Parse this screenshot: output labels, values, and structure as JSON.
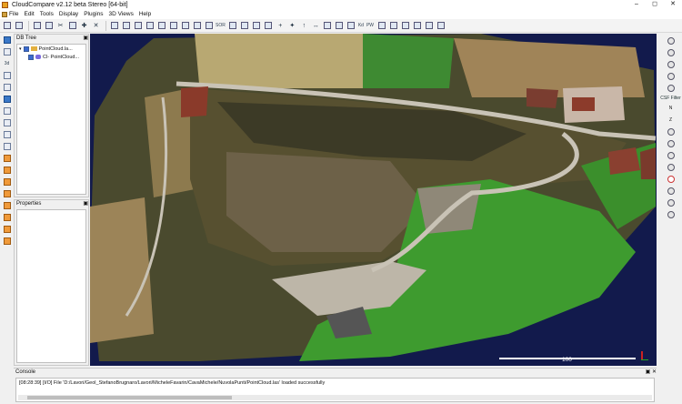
{
  "window": {
    "title": "CloudCompare v2.12 beta Stereo [64-bit]",
    "buttons": [
      "–",
      "◻",
      "✕"
    ]
  },
  "menu": [
    "File",
    "Edit",
    "Tools",
    "Display",
    "Plugins",
    "3D Views",
    "Help"
  ],
  "toolbar": {
    "sor_label": "SOR",
    "kd_label": "Kd",
    "pw_label": "PW"
  },
  "lefttools": {
    "label_3d": "3d"
  },
  "db_tree": {
    "title": "DB Tree",
    "items": [
      {
        "label": "PointCloud.la..."
      },
      {
        "label": "Cl- PointCloud..."
      }
    ]
  },
  "properties": {
    "title": "Properties"
  },
  "viewport": {
    "scale_label": "100"
  },
  "righttools": {
    "csf_label": "CSF Filter",
    "n_label": "N",
    "z_label": "Z"
  },
  "console": {
    "title": "Console",
    "line": "[08:28:39] [I/O] File 'D:/Lavori/Geol_StefanoBrugnaro/Lavori/MicheleFavarin/CavaMichele/NuvolaPunti/PointCloud.las' loaded successfully"
  }
}
